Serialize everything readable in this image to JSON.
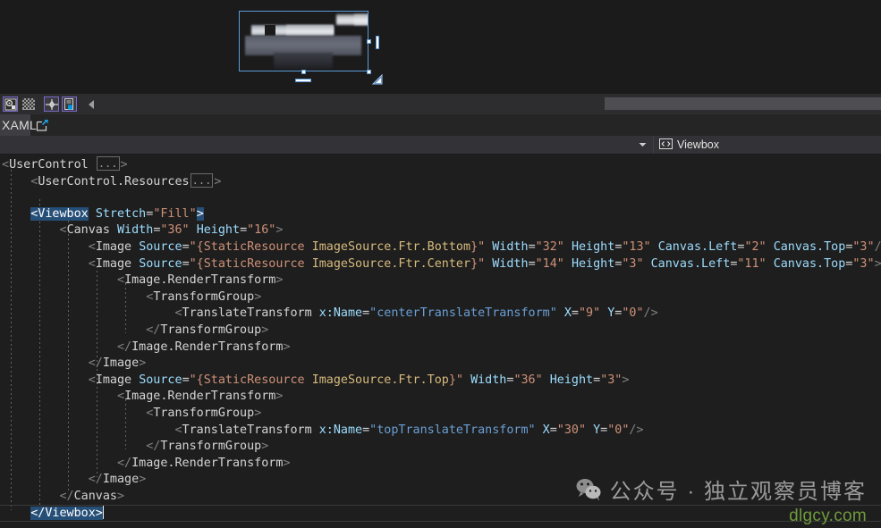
{
  "window": {
    "background": "#1b1b1c",
    "editor_background": "#1e1e1e"
  },
  "designer": {
    "name": "xaml-design-surface",
    "selected_element": "Viewbox",
    "selection_color": "#5b9bd5"
  },
  "designer_toolbar": {
    "buttons": [
      {
        "name": "zoom-settings-icon",
        "label": ""
      },
      {
        "name": "transparency-grid-icon",
        "label": ""
      },
      {
        "name": "snap-crosshair-icon",
        "label": ""
      },
      {
        "name": "artboard-icon",
        "label": ""
      }
    ],
    "collapse": {
      "name": "collapse-pane-icon",
      "label": ""
    }
  },
  "tabs": {
    "xaml_label": "XAML",
    "popout": {
      "name": "popout-window-icon",
      "label": ""
    }
  },
  "selector_bar": {
    "dropdown": {
      "name": "chevron-down-icon",
      "label": ""
    },
    "element_icon": "xml-element-icon",
    "element_name": "Viewbox"
  },
  "code": {
    "language": "XAML",
    "collapsed_marker": "...",
    "lines": [
      {
        "indent": 0,
        "segments": [
          {
            "t": "punct",
            "v": "<"
          },
          {
            "t": "tag",
            "v": "UserControl"
          },
          {
            "t": "plain",
            "v": " "
          },
          {
            "t": "collapse",
            "v": "..."
          },
          {
            "t": "punct",
            "v": ">"
          }
        ]
      },
      {
        "indent": 1,
        "segments": [
          {
            "t": "punct",
            "v": "<"
          },
          {
            "t": "tag",
            "v": "UserControl.Resources"
          },
          {
            "t": "collapse",
            "v": "..."
          },
          {
            "t": "punct",
            "v": ">"
          }
        ]
      },
      {
        "indent": 0,
        "segments": []
      },
      {
        "indent": 1,
        "segments": [
          {
            "t": "sel",
            "v": "<Viewbox"
          },
          {
            "t": "plain",
            "v": " "
          },
          {
            "t": "attr",
            "v": "Stretch"
          },
          {
            "t": "eq",
            "v": "="
          },
          {
            "t": "str",
            "v": "\"Fill\""
          },
          {
            "t": "sel",
            "v": ">"
          }
        ]
      },
      {
        "indent": 2,
        "segments": [
          {
            "t": "punct",
            "v": "<"
          },
          {
            "t": "tag",
            "v": "Canvas"
          },
          {
            "t": "plain",
            "v": " "
          },
          {
            "t": "attr",
            "v": "Width"
          },
          {
            "t": "eq",
            "v": "="
          },
          {
            "t": "str",
            "v": "\"36\""
          },
          {
            "t": "plain",
            "v": " "
          },
          {
            "t": "attr",
            "v": "Height"
          },
          {
            "t": "eq",
            "v": "="
          },
          {
            "t": "str",
            "v": "\"16\""
          },
          {
            "t": "punct",
            "v": ">"
          }
        ]
      },
      {
        "indent": 3,
        "segments": [
          {
            "t": "punct",
            "v": "<"
          },
          {
            "t": "tag",
            "v": "Image"
          },
          {
            "t": "plain",
            "v": " "
          },
          {
            "t": "attr",
            "v": "Source"
          },
          {
            "t": "eq",
            "v": "="
          },
          {
            "t": "str",
            "v": "\"{StaticResource "
          },
          {
            "t": "res",
            "v": "ImageSource.Ftr.Bottom"
          },
          {
            "t": "str",
            "v": "}\""
          },
          {
            "t": "plain",
            "v": " "
          },
          {
            "t": "attr",
            "v": "Width"
          },
          {
            "t": "eq",
            "v": "="
          },
          {
            "t": "str",
            "v": "\"32\""
          },
          {
            "t": "plain",
            "v": " "
          },
          {
            "t": "attr",
            "v": "Height"
          },
          {
            "t": "eq",
            "v": "="
          },
          {
            "t": "str",
            "v": "\"13\""
          },
          {
            "t": "plain",
            "v": " "
          },
          {
            "t": "attr",
            "v": "Canvas.Left"
          },
          {
            "t": "eq",
            "v": "="
          },
          {
            "t": "str",
            "v": "\"2\""
          },
          {
            "t": "plain",
            "v": " "
          },
          {
            "t": "attr",
            "v": "Canvas.Top"
          },
          {
            "t": "eq",
            "v": "="
          },
          {
            "t": "str",
            "v": "\"3\""
          },
          {
            "t": "punct",
            "v": "/>"
          }
        ]
      },
      {
        "indent": 3,
        "segments": [
          {
            "t": "punct",
            "v": "<"
          },
          {
            "t": "tag",
            "v": "Image"
          },
          {
            "t": "plain",
            "v": " "
          },
          {
            "t": "attr",
            "v": "Source"
          },
          {
            "t": "eq",
            "v": "="
          },
          {
            "t": "str",
            "v": "\"{StaticResource "
          },
          {
            "t": "res",
            "v": "ImageSource.Ftr.Center"
          },
          {
            "t": "str",
            "v": "}\""
          },
          {
            "t": "plain",
            "v": " "
          },
          {
            "t": "attr",
            "v": "Width"
          },
          {
            "t": "eq",
            "v": "="
          },
          {
            "t": "str",
            "v": "\"14\""
          },
          {
            "t": "plain",
            "v": " "
          },
          {
            "t": "attr",
            "v": "Height"
          },
          {
            "t": "eq",
            "v": "="
          },
          {
            "t": "str",
            "v": "\"3\""
          },
          {
            "t": "plain",
            "v": " "
          },
          {
            "t": "attr",
            "v": "Canvas.Left"
          },
          {
            "t": "eq",
            "v": "="
          },
          {
            "t": "str",
            "v": "\"11\""
          },
          {
            "t": "plain",
            "v": " "
          },
          {
            "t": "attr",
            "v": "Canvas.Top"
          },
          {
            "t": "eq",
            "v": "="
          },
          {
            "t": "str",
            "v": "\"3\""
          },
          {
            "t": "punct",
            "v": ">"
          }
        ]
      },
      {
        "indent": 4,
        "segments": [
          {
            "t": "punct",
            "v": "<"
          },
          {
            "t": "tag",
            "v": "Image.RenderTransform"
          },
          {
            "t": "punct",
            "v": ">"
          }
        ]
      },
      {
        "indent": 5,
        "segments": [
          {
            "t": "punct",
            "v": "<"
          },
          {
            "t": "tag",
            "v": "TransformGroup"
          },
          {
            "t": "punct",
            "v": ">"
          }
        ]
      },
      {
        "indent": 6,
        "segments": [
          {
            "t": "punct",
            "v": "<"
          },
          {
            "t": "tag",
            "v": "TranslateTransform"
          },
          {
            "t": "plain",
            "v": " "
          },
          {
            "t": "attr",
            "v": "x:Name"
          },
          {
            "t": "eq",
            "v": "="
          },
          {
            "t": "strnum",
            "v": "\"centerTranslateTransform\""
          },
          {
            "t": "plain",
            "v": " "
          },
          {
            "t": "attr",
            "v": "X"
          },
          {
            "t": "eq",
            "v": "="
          },
          {
            "t": "str",
            "v": "\"9\""
          },
          {
            "t": "plain",
            "v": " "
          },
          {
            "t": "attr",
            "v": "Y"
          },
          {
            "t": "eq",
            "v": "="
          },
          {
            "t": "str",
            "v": "\"0\""
          },
          {
            "t": "punct",
            "v": "/>"
          }
        ]
      },
      {
        "indent": 5,
        "segments": [
          {
            "t": "punct",
            "v": "</"
          },
          {
            "t": "tag",
            "v": "TransformGroup"
          },
          {
            "t": "punct",
            "v": ">"
          }
        ]
      },
      {
        "indent": 4,
        "segments": [
          {
            "t": "punct",
            "v": "</"
          },
          {
            "t": "tag",
            "v": "Image.RenderTransform"
          },
          {
            "t": "punct",
            "v": ">"
          }
        ]
      },
      {
        "indent": 3,
        "segments": [
          {
            "t": "punct",
            "v": "</"
          },
          {
            "t": "tag",
            "v": "Image"
          },
          {
            "t": "punct",
            "v": ">"
          }
        ]
      },
      {
        "indent": 3,
        "segments": [
          {
            "t": "punct",
            "v": "<"
          },
          {
            "t": "tag",
            "v": "Image"
          },
          {
            "t": "plain",
            "v": " "
          },
          {
            "t": "attr",
            "v": "Source"
          },
          {
            "t": "eq",
            "v": "="
          },
          {
            "t": "str",
            "v": "\"{StaticResource "
          },
          {
            "t": "res",
            "v": "ImageSource.Ftr.Top"
          },
          {
            "t": "str",
            "v": "}\""
          },
          {
            "t": "plain",
            "v": " "
          },
          {
            "t": "attr",
            "v": "Width"
          },
          {
            "t": "eq",
            "v": "="
          },
          {
            "t": "str",
            "v": "\"36\""
          },
          {
            "t": "plain",
            "v": " "
          },
          {
            "t": "attr",
            "v": "Height"
          },
          {
            "t": "eq",
            "v": "="
          },
          {
            "t": "str",
            "v": "\"3\""
          },
          {
            "t": "punct",
            "v": ">"
          }
        ]
      },
      {
        "indent": 4,
        "segments": [
          {
            "t": "punct",
            "v": "<"
          },
          {
            "t": "tag",
            "v": "Image.RenderTransform"
          },
          {
            "t": "punct",
            "v": ">"
          }
        ]
      },
      {
        "indent": 5,
        "segments": [
          {
            "t": "punct",
            "v": "<"
          },
          {
            "t": "tag",
            "v": "TransformGroup"
          },
          {
            "t": "punct",
            "v": ">"
          }
        ]
      },
      {
        "indent": 6,
        "segments": [
          {
            "t": "punct",
            "v": "<"
          },
          {
            "t": "tag",
            "v": "TranslateTransform"
          },
          {
            "t": "plain",
            "v": " "
          },
          {
            "t": "attr",
            "v": "x:Name"
          },
          {
            "t": "eq",
            "v": "="
          },
          {
            "t": "strnum",
            "v": "\"topTranslateTransform\""
          },
          {
            "t": "plain",
            "v": " "
          },
          {
            "t": "attr",
            "v": "X"
          },
          {
            "t": "eq",
            "v": "="
          },
          {
            "t": "str",
            "v": "\"30\""
          },
          {
            "t": "plain",
            "v": " "
          },
          {
            "t": "attr",
            "v": "Y"
          },
          {
            "t": "eq",
            "v": "="
          },
          {
            "t": "str",
            "v": "\"0\""
          },
          {
            "t": "punct",
            "v": "/>"
          }
        ]
      },
      {
        "indent": 5,
        "segments": [
          {
            "t": "punct",
            "v": "</"
          },
          {
            "t": "tag",
            "v": "TransformGroup"
          },
          {
            "t": "punct",
            "v": ">"
          }
        ]
      },
      {
        "indent": 4,
        "segments": [
          {
            "t": "punct",
            "v": "</"
          },
          {
            "t": "tag",
            "v": "Image.RenderTransform"
          },
          {
            "t": "punct",
            "v": ">"
          }
        ]
      },
      {
        "indent": 3,
        "segments": [
          {
            "t": "punct",
            "v": "</"
          },
          {
            "t": "tag",
            "v": "Image"
          },
          {
            "t": "punct",
            "v": ">"
          }
        ]
      },
      {
        "indent": 2,
        "segments": [
          {
            "t": "punct",
            "v": "</"
          },
          {
            "t": "tag",
            "v": "Canvas"
          },
          {
            "t": "punct",
            "v": ">"
          }
        ]
      },
      {
        "indent": 1,
        "current": true,
        "segments": [
          {
            "t": "sel",
            "v": "</Viewbox>"
          },
          {
            "t": "caret",
            "v": ""
          }
        ]
      }
    ]
  },
  "watermark": {
    "icon": "wechat-icon",
    "text": "公众号 · 独立观察员博客",
    "url": "dlgcy.com",
    "url_color": "#6f9a3c"
  }
}
